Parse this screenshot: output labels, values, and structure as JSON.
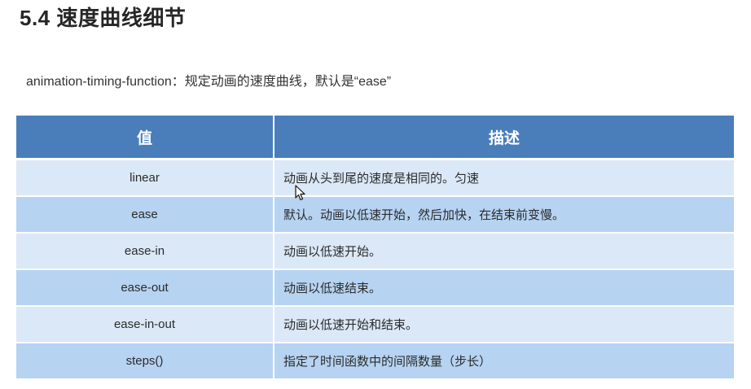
{
  "title": "5.4 速度曲线细节",
  "intro": "animation-timing-function：规定动画的速度曲线，默认是“ease”",
  "table": {
    "headers": [
      "值",
      "描述"
    ],
    "rows": [
      {
        "value": "linear",
        "description": "动画从头到尾的速度是相同的。匀速"
      },
      {
        "value": "ease",
        "description": "默认。动画以低速开始，然后加快，在结束前变慢。"
      },
      {
        "value": "ease-in",
        "description": "动画以低速开始。"
      },
      {
        "value": "ease-out",
        "description": "动画以低速结束。"
      },
      {
        "value": "ease-in-out",
        "description": "动画以低速开始和结束。"
      },
      {
        "value": "steps()",
        "description": "指定了时间函数中的间隔数量（步长）"
      }
    ]
  },
  "colors": {
    "header_bg": "#4a7ebb",
    "row_light": "#dbe8f7",
    "row_dark": "#b6d3f1"
  },
  "icons": [
    "mouse-cursor-icon"
  ]
}
